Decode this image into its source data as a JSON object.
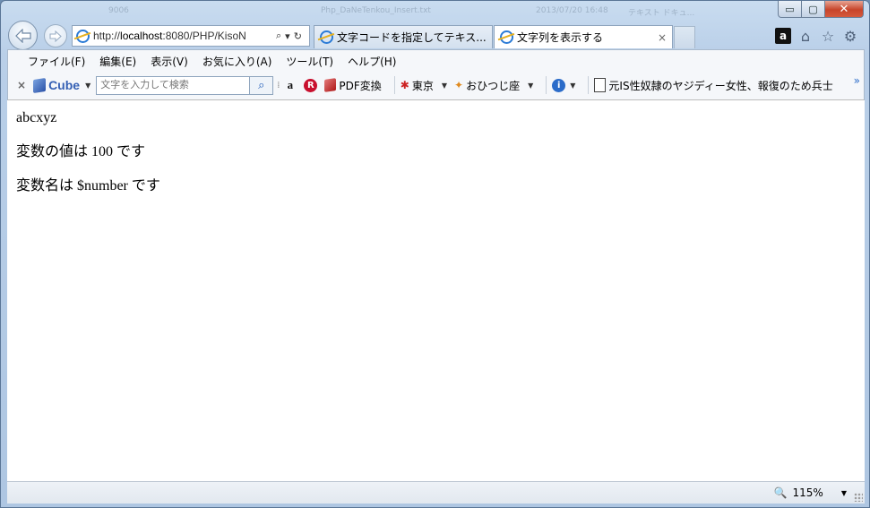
{
  "window": {
    "ghost_titles": [
      "9006",
      "Php_DaNeTenkou_Insert.txt",
      "2013/07/20 16:48",
      "テキスト ドキュ..."
    ]
  },
  "caption": {
    "minimize": "▭",
    "maximize": "▢",
    "close": "✕"
  },
  "address_bar": {
    "prefix": "http://",
    "host": "localhost",
    "rest": ":8080/PHP/KisoN"
  },
  "tabs": [
    {
      "label": "文字コードを指定してテキス..."
    },
    {
      "label": "文字列を表示する",
      "close": "×"
    }
  ],
  "right_icons": {
    "amazon": "a"
  },
  "menu": [
    "ファイル(F)",
    "編集(E)",
    "表示(V)",
    "お気に入り(A)",
    "ツール(T)",
    "ヘルプ(H)"
  ],
  "toolbar": {
    "close": "×",
    "brand": "Cube",
    "search_placeholder": "文字を入力して検索",
    "amazon_letter": "a",
    "rakuten_letter": "R",
    "pdf_label": "PDF変換",
    "weather_label": "東京",
    "horoscope_label": "おひつじ座",
    "news_label": "元IS性奴隷のヤジディー女性、報復のため兵士",
    "overflow": "»"
  },
  "content": {
    "lines": [
      "abcxyz",
      "変数の値は 100 です",
      "変数名は $number です"
    ]
  },
  "status": {
    "zoom": "115%"
  },
  "colors": {
    "accent": "#2b7bd6",
    "close": "#c7442a"
  }
}
